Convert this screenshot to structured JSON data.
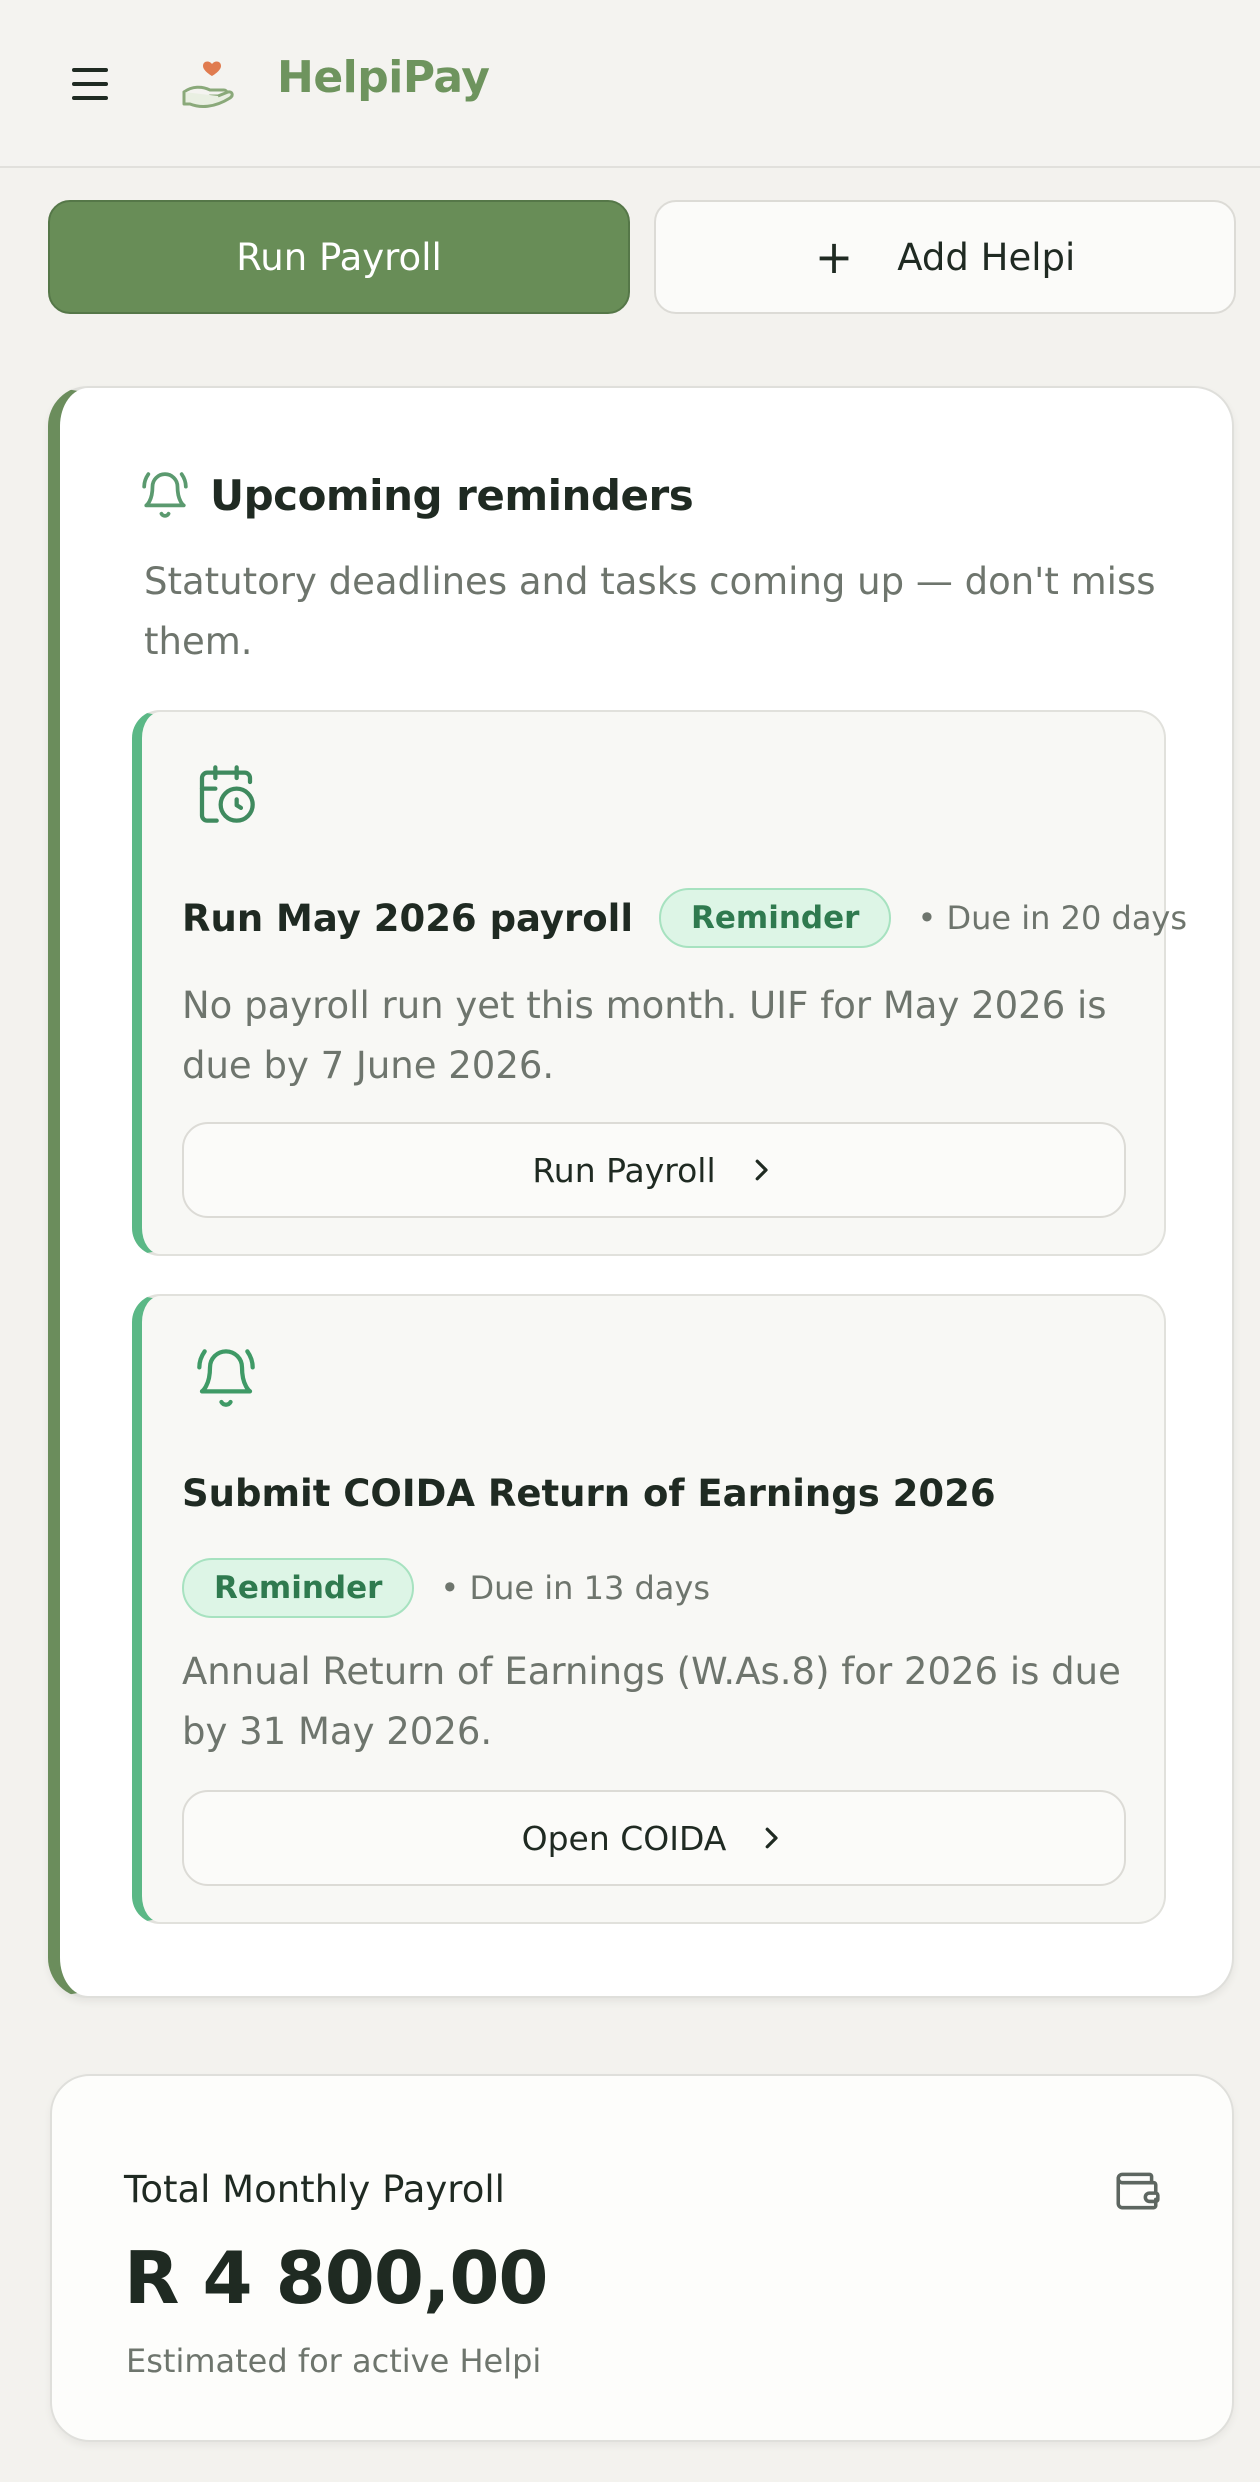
{
  "header": {
    "brand_name": "HelpiPay",
    "menu_icon": "hamburger-menu-icon",
    "logo_icon": "hand-heart-logo-icon",
    "brand_color": "#6e945e"
  },
  "actions": {
    "run_payroll_label": "Run Payroll",
    "add_helpi_label": "Add Helpi",
    "add_icon": "plus-icon"
  },
  "reminders": {
    "icon": "bell-icon",
    "title": "Upcoming reminders",
    "description": "Statutory deadlines and tasks coming up — don't miss them.",
    "items": [
      {
        "icon": "calendar-clock-icon",
        "title": "Run May 2026 payroll",
        "badge": "Reminder",
        "due": "• Due in 20 days",
        "description": "No payroll run yet this month. UIF for May 2026 is due by 7 June 2026.",
        "action_label": "Run Payroll",
        "action_icon": "chevron-right-icon"
      },
      {
        "icon": "bell-icon",
        "title": "Submit COIDA Return of Earnings 2026",
        "badge": "Reminder",
        "due": "• Due in 13 days",
        "description": "Annual Return of Earnings (W.As.8) for 2026 is due by 31 May 2026.",
        "action_label": "Open COIDA",
        "action_icon": "chevron-right-icon"
      }
    ]
  },
  "summary": {
    "label": "Total Monthly Payroll",
    "value": "R 4 800,00",
    "subtitle": "Estimated for active Helpi",
    "icon": "wallet-icon"
  },
  "colors": {
    "primary": "#688d57",
    "accent_green": "#5bb886",
    "badge_bg": "#ddf5e6",
    "badge_text": "#2f7a4f",
    "muted_text": "#6e756d"
  }
}
